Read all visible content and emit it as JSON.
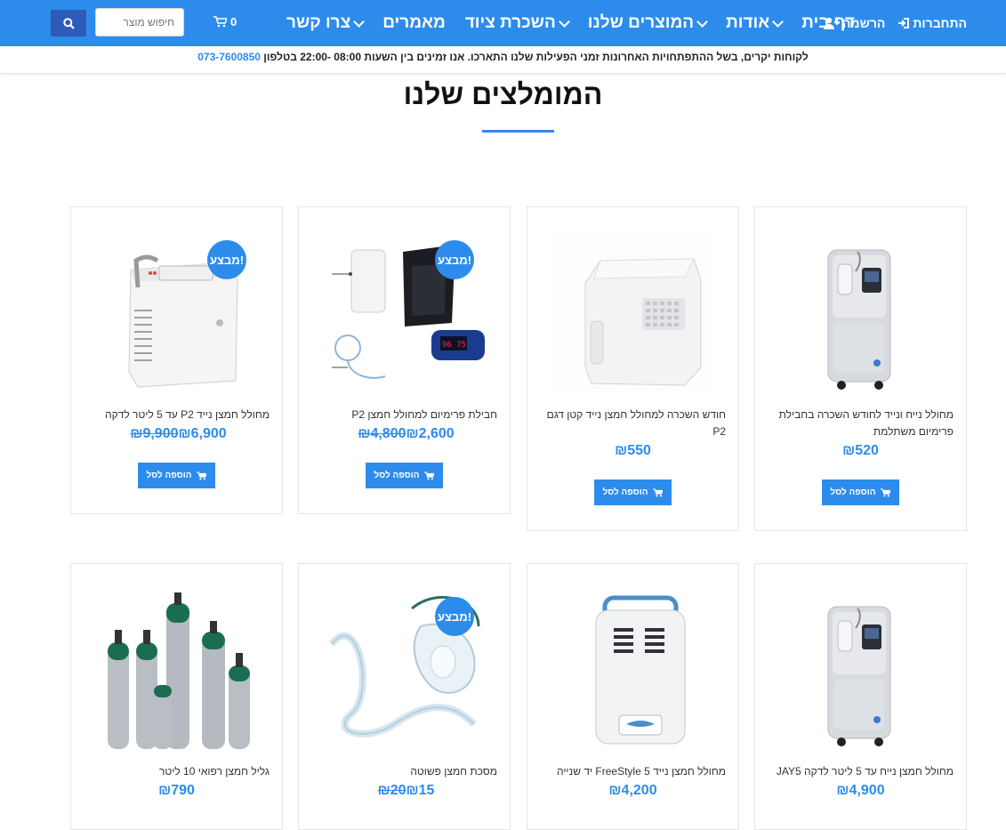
{
  "header": {
    "nav": [
      {
        "label": "דף בית",
        "dropdown": false
      },
      {
        "label": "אודות",
        "dropdown": true
      },
      {
        "label": "המוצרים שלנו",
        "dropdown": true
      },
      {
        "label": "השכרת ציוד",
        "dropdown": true
      },
      {
        "label": "מאמרים",
        "dropdown": false
      },
      {
        "label": "צרו קשר",
        "dropdown": true
      }
    ],
    "login_label": "התחברות",
    "register_label": "הרשמה",
    "cart_count": "0",
    "search_placeholder": "חיפוש מוצר"
  },
  "notice": {
    "text": "לקוחות יקרים, בשל ההתפתחויות האחרונות זמני הפעילות שלנו התארכו. אנו זמינים בין השעות 08:00 -22:00 בטלפון ",
    "phone": "073-7600850"
  },
  "section": {
    "title": "המומלצים שלנו"
  },
  "products": [
    {
      "name": "מחולל נייח ונייד לחודש השכרה בחבילת פרימיום משתלמת",
      "price": "₪520",
      "old_price": "",
      "sale": false,
      "image": "stationary-concentrator"
    },
    {
      "name": "חודש השכרה למחולל חמצן נייד קטן דגם P2",
      "price": "₪550",
      "old_price": "",
      "sale": false,
      "image": "portable-concentrator-white"
    },
    {
      "name": "חבילת פרימיום למחולל חמצן P2",
      "price": "₪2,600",
      "old_price": "₪4,800",
      "sale": true,
      "image": "premium-bundle"
    },
    {
      "name": "מחולל חמצן נייד P2 עד 5 ליטר לדקה",
      "price": "₪6,900",
      "old_price": "₪9,900",
      "sale": true,
      "image": "portable-concentrator-p2"
    },
    {
      "name": "מחולל חמצן נייח עד 5 ליטר לדקה JAY5",
      "price": "₪4,900",
      "old_price": "",
      "sale": false,
      "image": "stationary-concentrator"
    },
    {
      "name": "מחולל חמצן נייד FreeStyle 5 יד שנייה",
      "price": "₪4,200",
      "old_price": "",
      "sale": false,
      "image": "freestyle-concentrator"
    },
    {
      "name": "מסכת חמצן פשוטה",
      "price": "₪15",
      "old_price": "₪20",
      "sale": true,
      "image": "oxygen-mask"
    },
    {
      "name": "גליל חמצן רפואי 10 ליטר",
      "price": "₪790",
      "old_price": "",
      "sale": false,
      "image": "oxygen-cylinders"
    }
  ],
  "labels": {
    "sale_badge": "מבצע!",
    "add_to_cart": "הוספה לסל"
  },
  "colors": {
    "primary": "#2d8ceb",
    "search_button": "#2e5ab8"
  }
}
